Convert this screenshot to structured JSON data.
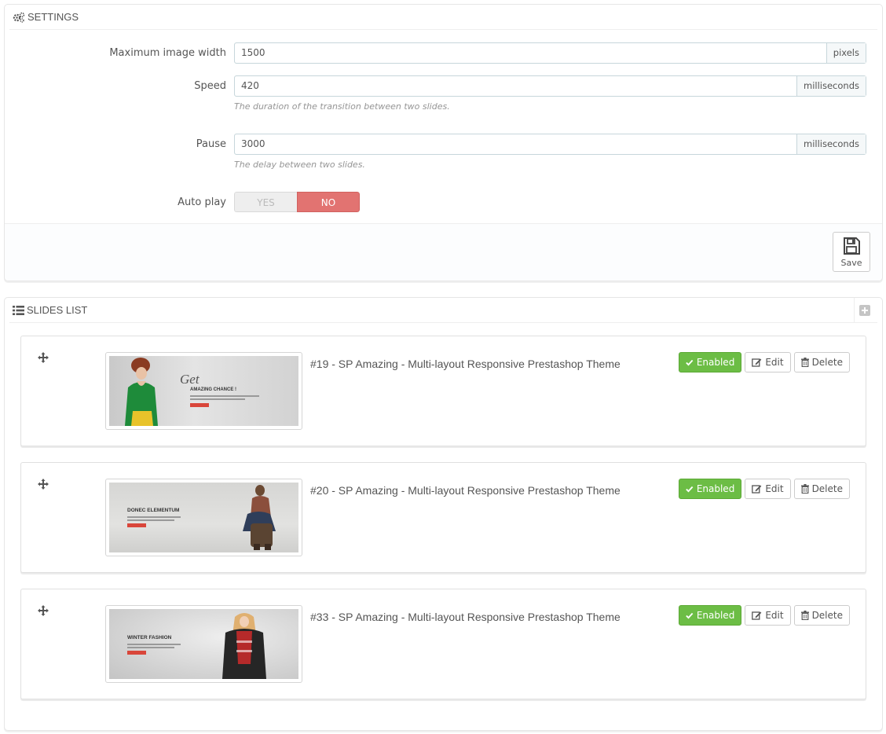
{
  "settings": {
    "title": "SETTINGS",
    "max_width_label": "Maximum image width",
    "max_width_value": "1500",
    "max_width_unit": "pixels",
    "speed_label": "Speed",
    "speed_value": "420",
    "speed_unit": "milliseconds",
    "speed_help": "The duration of the transition between two slides.",
    "pause_label": "Pause",
    "pause_value": "3000",
    "pause_unit": "milliseconds",
    "pause_help": "The delay between two slides.",
    "autoplay_label": "Auto play",
    "autoplay_yes": "YES",
    "autoplay_no": "NO",
    "autoplay_selected": "NO",
    "save_label": "Save"
  },
  "slides_list": {
    "title": "SLIDES LIST",
    "slides": [
      {
        "title": "#19 - SP Amazing - Multi-layout Responsive Prestashop Theme",
        "status_label": "Enabled",
        "edit_label": "Edit",
        "delete_label": "Delete",
        "thumb_heading": "AMAZING CHANCE !",
        "thumb_script": "Get"
      },
      {
        "title": "#20 - SP Amazing - Multi-layout Responsive Prestashop Theme",
        "status_label": "Enabled",
        "edit_label": "Edit",
        "delete_label": "Delete",
        "thumb_heading": "DONEC ELEMENTUM"
      },
      {
        "title": "#33 - SP Amazing - Multi-layout Responsive Prestashop Theme",
        "status_label": "Enabled",
        "edit_label": "Edit",
        "delete_label": "Delete",
        "thumb_heading": "WINTER FASHION"
      }
    ]
  },
  "colors": {
    "enabled_green": "#6cbd45",
    "no_red": "#e27371",
    "thumb_button_red": "#d9463a"
  },
  "icons": {
    "settings": "cogs-icon",
    "slides_list": "list-icon",
    "save": "floppy-disk-icon",
    "add": "plus-square-icon",
    "drag": "move-arrows-icon",
    "enabled": "check-icon",
    "edit": "pencil-square-icon",
    "delete": "trash-icon"
  }
}
